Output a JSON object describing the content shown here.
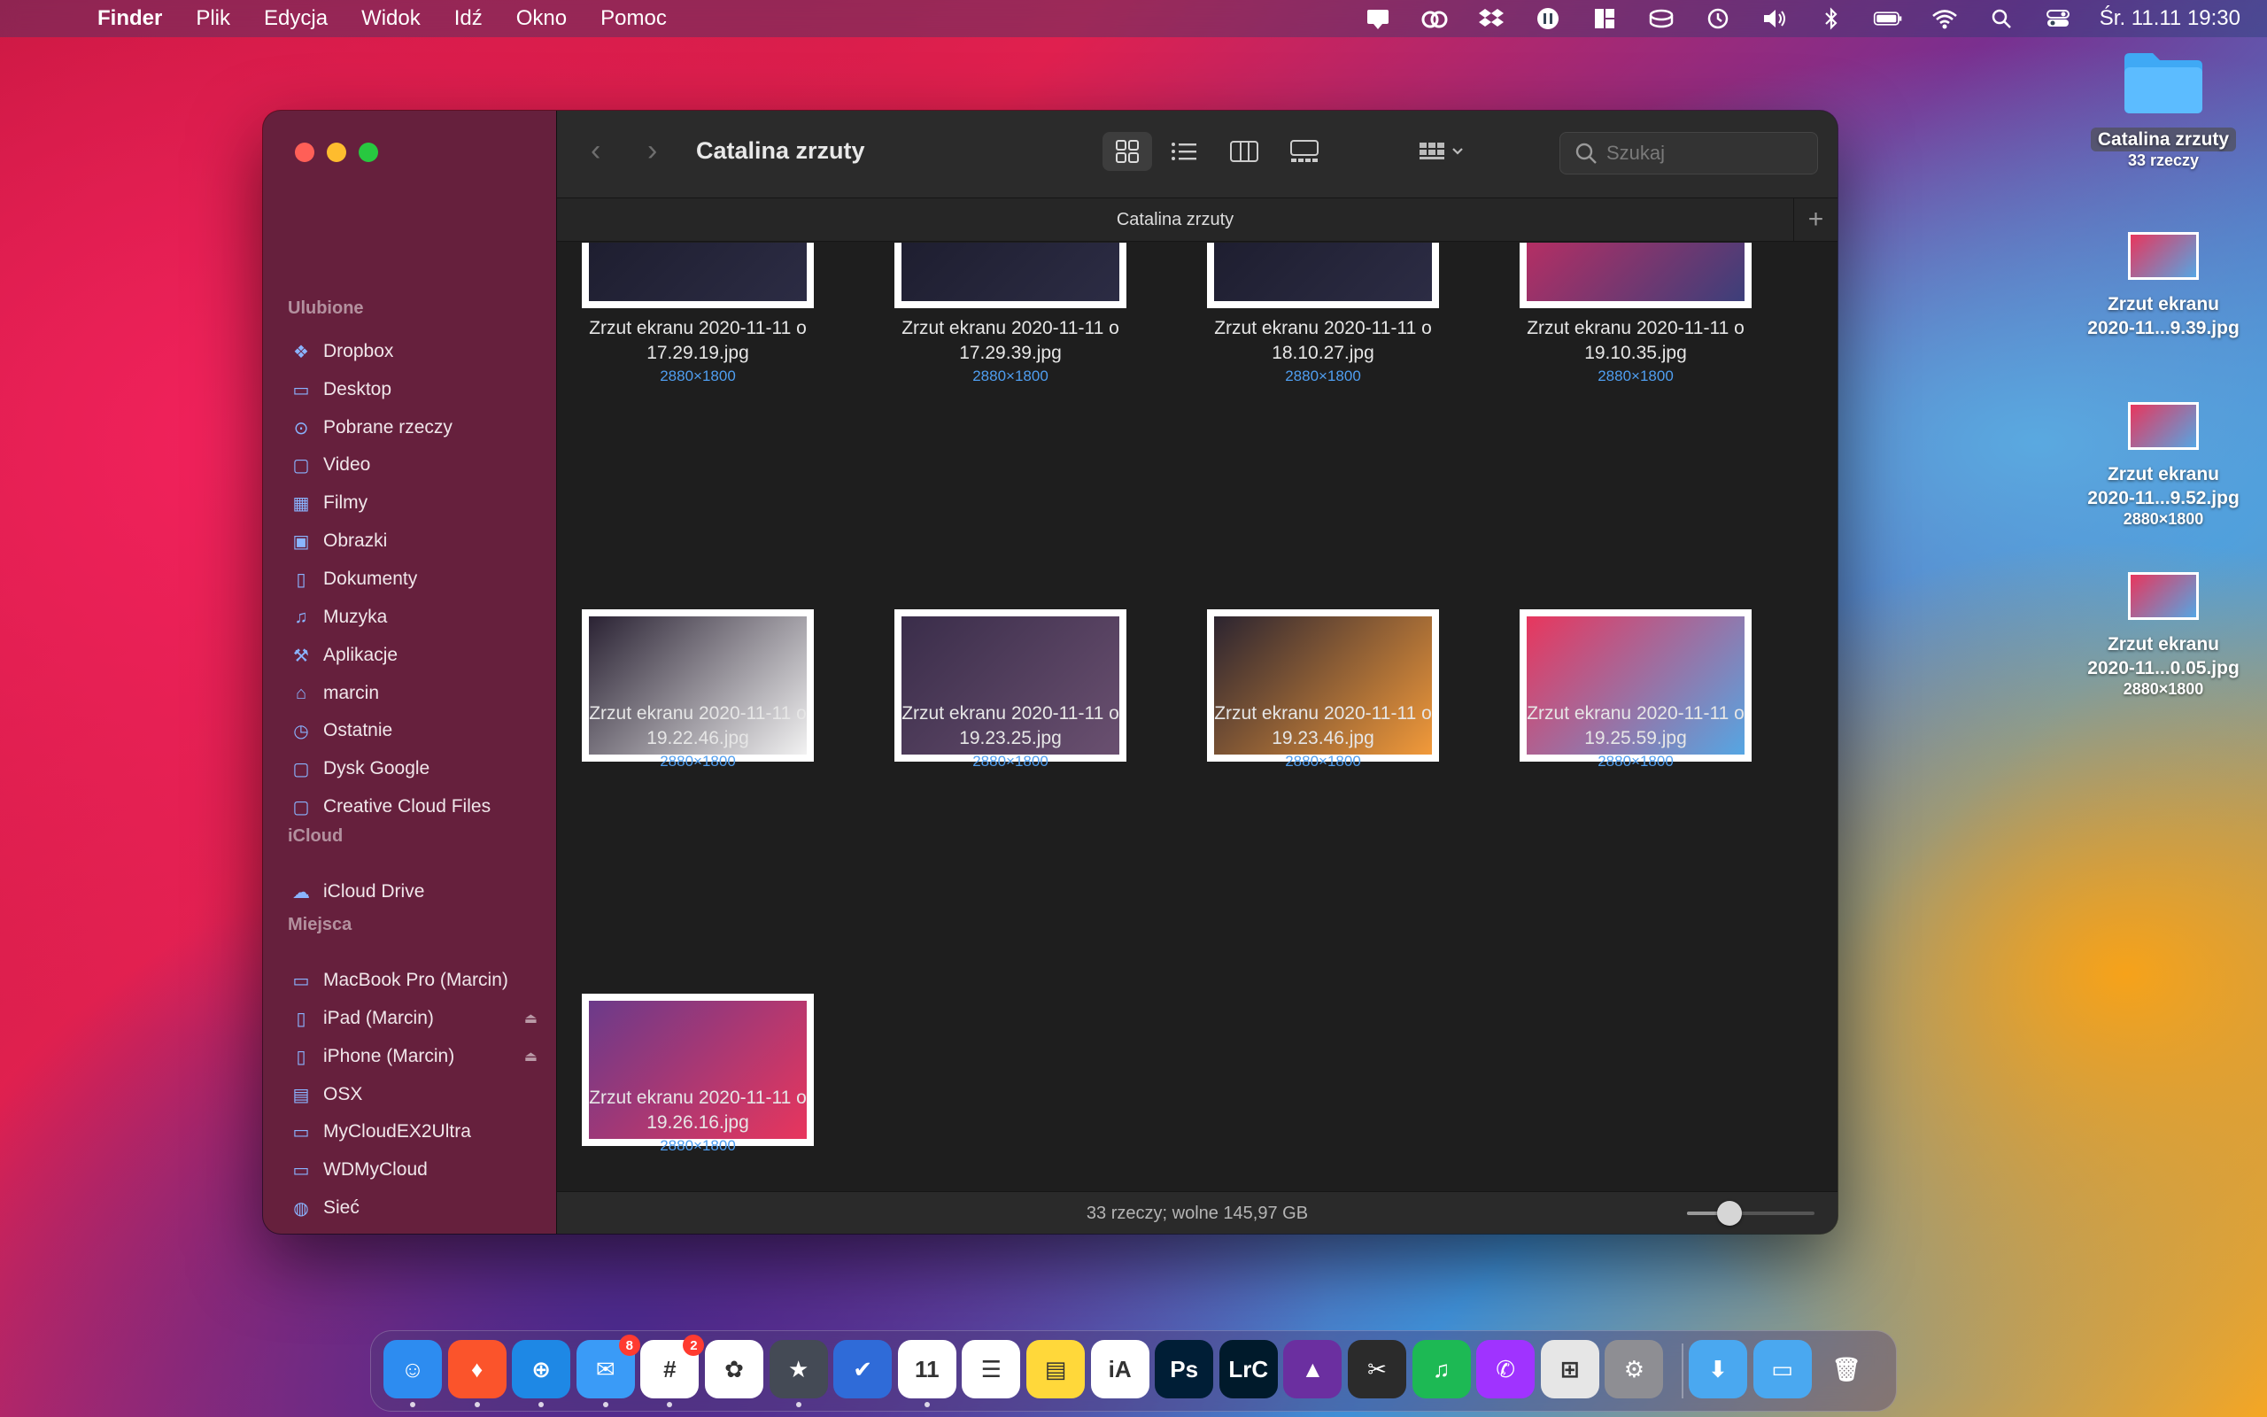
{
  "menubar": {
    "app_name": "Finder",
    "items": [
      "Plik",
      "Edycja",
      "Widok",
      "Idź",
      "Okno",
      "Pomoc"
    ],
    "clock": "Śr. 11.11  19:30",
    "status_icons": [
      "notification-icon",
      "creative-cloud-icon",
      "dropbox-icon",
      "hand-icon",
      "magnet-icon",
      "disk-icon",
      "time-machine-icon",
      "volume-icon",
      "bluetooth-icon",
      "battery-icon",
      "wifi-icon",
      "search-icon",
      "control-center-icon"
    ]
  },
  "window": {
    "title": "Catalina zrzuty",
    "tab_label": "Catalina zrzuty",
    "search_placeholder": "Szukaj",
    "status": "33 rzeczy; wolne 145,97 GB",
    "zoom_level": 0.33
  },
  "sidebar": {
    "sections": [
      {
        "title": "Ulubione",
        "items": [
          {
            "label": "Dropbox",
            "icon": "dropbox-icon"
          },
          {
            "label": "Desktop",
            "icon": "desktop-icon"
          },
          {
            "label": "Pobrane rzeczy",
            "icon": "download-icon"
          },
          {
            "label": "Video",
            "icon": "folder-icon"
          },
          {
            "label": "Filmy",
            "icon": "film-icon"
          },
          {
            "label": "Obrazki",
            "icon": "photo-icon"
          },
          {
            "label": "Dokumenty",
            "icon": "document-icon"
          },
          {
            "label": "Muzyka",
            "icon": "music-icon"
          },
          {
            "label": "Aplikacje",
            "icon": "apps-icon"
          },
          {
            "label": "marcin",
            "icon": "home-icon"
          },
          {
            "label": "Ostatnie",
            "icon": "clock-icon"
          },
          {
            "label": "Dysk Google",
            "icon": "folder-icon"
          },
          {
            "label": "Creative Cloud Files",
            "icon": "folder-icon"
          }
        ]
      },
      {
        "title": "iCloud",
        "items": [
          {
            "label": "iCloud Drive",
            "icon": "cloud-icon"
          }
        ]
      },
      {
        "title": "Miejsca",
        "items": [
          {
            "label": "MacBook Pro (Marcin)",
            "icon": "laptop-icon"
          },
          {
            "label": "iPad (Marcin)",
            "icon": "tablet-icon",
            "eject": true
          },
          {
            "label": "iPhone (Marcin)",
            "icon": "phone-icon",
            "eject": true
          },
          {
            "label": "OSX",
            "icon": "drive-icon"
          },
          {
            "label": "MyCloudEX2Ultra",
            "icon": "monitor-icon"
          },
          {
            "label": "WDMyCloud",
            "icon": "monitor-icon"
          },
          {
            "label": "Sieć",
            "icon": "globe-icon"
          }
        ]
      }
    ]
  },
  "files": [
    {
      "name_line1": "Zrzut ekranu 2020-11-11 o",
      "name_line2": "17.29.19.jpg",
      "size": "2880×1800"
    },
    {
      "name_line1": "Zrzut ekranu 2020-11-11 o",
      "name_line2": "17.29.39.jpg",
      "size": "2880×1800"
    },
    {
      "name_line1": "Zrzut ekranu 2020-11-11 o",
      "name_line2": "18.10.27.jpg",
      "size": "2880×1800"
    },
    {
      "name_line1": "Zrzut ekranu 2020-11-11 o",
      "name_line2": "19.10.35.jpg",
      "size": "2880×1800"
    },
    {
      "name_line1": "Zrzut ekranu 2020-11-11 o",
      "name_line2": "19.22.46.jpg",
      "size": "2880×1800"
    },
    {
      "name_line1": "Zrzut ekranu 2020-11-11 o",
      "name_line2": "19.23.25.jpg",
      "size": "2880×1800"
    },
    {
      "name_line1": "Zrzut ekranu 2020-11-11 o",
      "name_line2": "19.23.46.jpg",
      "size": "2880×1800"
    },
    {
      "name_line1": "Zrzut ekranu 2020-11-11 o",
      "name_line2": "19.25.59.jpg",
      "size": "2880×1800"
    },
    {
      "name_line1": "Zrzut ekranu 2020-11-11 o",
      "name_line2": "19.26.16.jpg",
      "size": "2880×1800"
    }
  ],
  "desktop": [
    {
      "line1": "Catalina zrzuty",
      "line2": "",
      "sub": "33 rzeczy",
      "kind": "folder"
    },
    {
      "line1": "Zrzut ekranu",
      "line2": "2020-11...9.39.jpg",
      "sub": "",
      "kind": "image"
    },
    {
      "line1": "Zrzut ekranu",
      "line2": "2020-11...9.52.jpg",
      "sub": "2880×1800",
      "kind": "image"
    },
    {
      "line1": "Zrzut ekranu",
      "line2": "2020-11...0.05.jpg",
      "sub": "2880×1800",
      "kind": "image"
    }
  ],
  "dock": {
    "apps": [
      {
        "name": "finder-icon",
        "glyph": "☺",
        "bg": "#2d8cf0",
        "dot": true
      },
      {
        "name": "brave-icon",
        "glyph": "♦",
        "bg": "#fb542b",
        "dot": true
      },
      {
        "name": "safari-icon",
        "glyph": "⊕",
        "bg": "#1e88e5",
        "dot": true
      },
      {
        "name": "mail-icon",
        "glyph": "✉",
        "bg": "#3a9bf7",
        "badge": "8",
        "dot": true
      },
      {
        "name": "slack-icon",
        "glyph": "#",
        "bg": "#ffffff",
        "badge": "2",
        "dot": true
      },
      {
        "name": "photos-icon",
        "glyph": "✿",
        "bg": "#ffffff",
        "dot": false
      },
      {
        "name": "screenium-icon",
        "glyph": "★",
        "bg": "#444a55",
        "dot": true
      },
      {
        "name": "omnifocus-icon",
        "glyph": "✔",
        "bg": "#2f6bd8",
        "dot": false
      },
      {
        "name": "calendar-icon",
        "glyph": "11",
        "bg": "#ffffff",
        "dot": true
      },
      {
        "name": "reminders-icon",
        "glyph": "☰",
        "bg": "#ffffff",
        "dot": false
      },
      {
        "name": "notes-icon",
        "glyph": "▤",
        "bg": "#ffd83a",
        "dot": false
      },
      {
        "name": "ia-writer-icon",
        "glyph": "iA",
        "bg": "#ffffff",
        "dot": false
      },
      {
        "name": "photoshop-icon",
        "glyph": "Ps",
        "bg": "#001e36",
        "dot": false
      },
      {
        "name": "lightroom-icon",
        "glyph": "LrC",
        "bg": "#001a2b",
        "dot": false
      },
      {
        "name": "affinity-icon",
        "glyph": "▲",
        "bg": "#6b2fa0",
        "dot": false
      },
      {
        "name": "final-cut-icon",
        "glyph": "✂",
        "bg": "#2b2b2b",
        "dot": false
      },
      {
        "name": "spotify-icon",
        "glyph": "♫",
        "bg": "#1db954",
        "dot": false
      },
      {
        "name": "messenger-icon",
        "glyph": "✆",
        "bg": "#a033ff",
        "dot": false
      },
      {
        "name": "launchpad-icon",
        "glyph": "⊞",
        "bg": "#e6e6e6",
        "dot": false
      },
      {
        "name": "settings-icon",
        "glyph": "⚙",
        "bg": "#8e8e93",
        "dot": false
      },
      {
        "name": "downloads-stack-icon",
        "glyph": "⬇",
        "bg": "#4aa8f0",
        "dot": false
      },
      {
        "name": "folder-stack-icon",
        "glyph": "▭",
        "bg": "#4aa8f0",
        "dot": false
      },
      {
        "name": "trash-icon",
        "glyph": "🗑",
        "bg": "transparent",
        "dot": false
      }
    ]
  }
}
